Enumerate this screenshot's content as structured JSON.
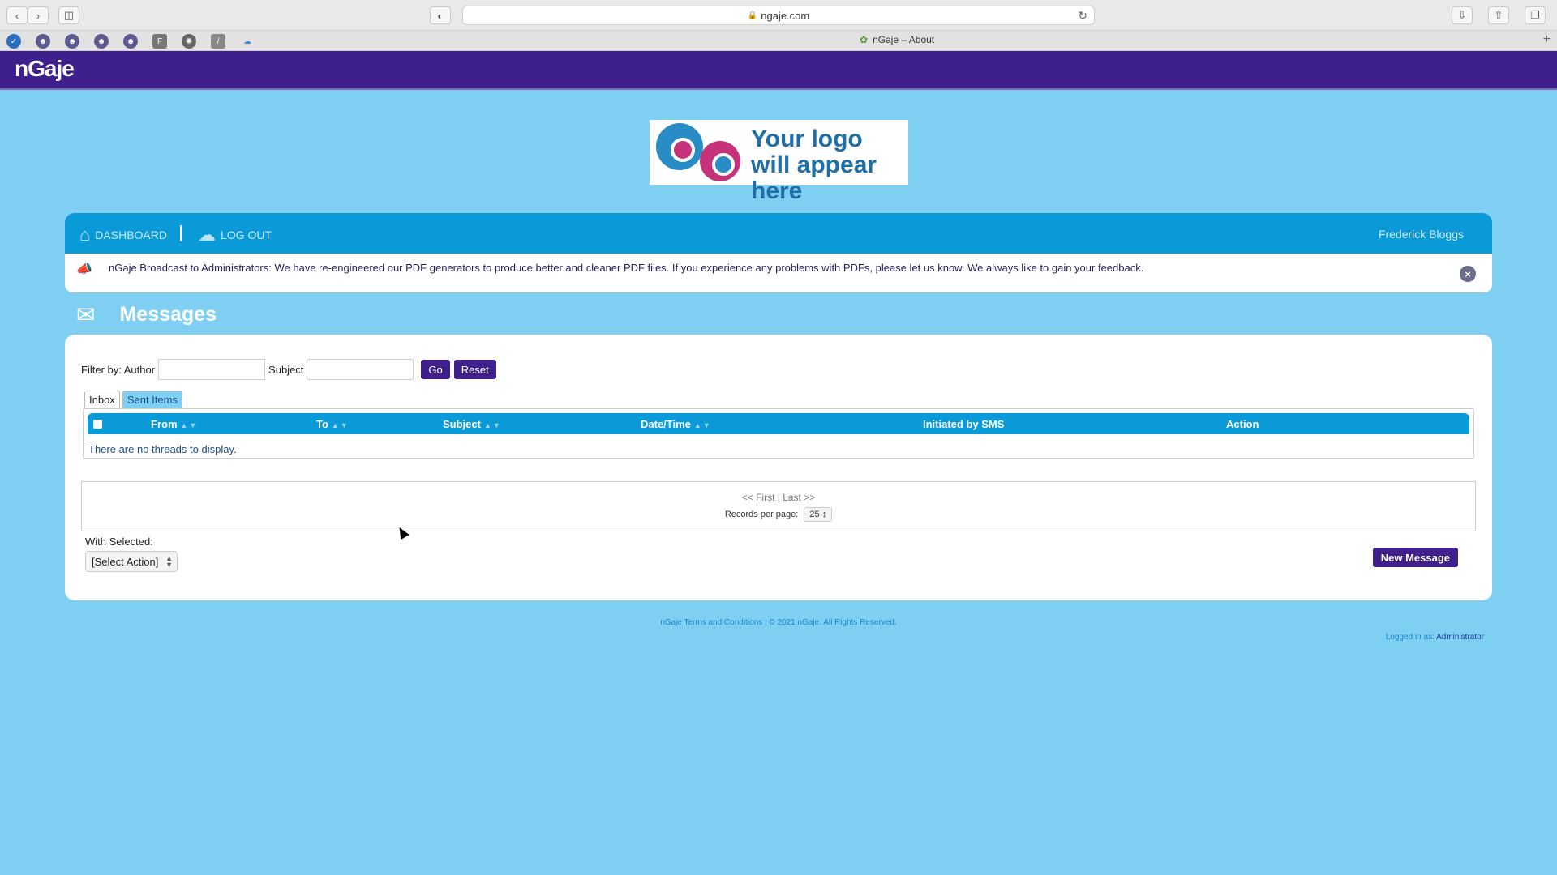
{
  "browser": {
    "url": "ngaje.com",
    "tab_title": "nGaje – About"
  },
  "app": {
    "brand": "nGaje"
  },
  "client_logo": {
    "text": "Your logo will appear here"
  },
  "nav": {
    "dashboard": "DASHBOARD",
    "logout": "LOG OUT",
    "user": "Frederick Bloggs"
  },
  "broadcast": {
    "message": "nGaje Broadcast to Administrators: We have re-engineered our PDF generators to produce better and cleaner PDF files. If you experience any problems with PDFs, please let us know. We always like to gain your feedback."
  },
  "page": {
    "title": "Messages"
  },
  "filter": {
    "label_author": "Filter by: Author",
    "label_subject": "Subject",
    "author_value": "",
    "subject_value": "",
    "go": "Go",
    "reset": "Reset"
  },
  "tabs": {
    "inbox": "Inbox",
    "sent": "Sent Items"
  },
  "table": {
    "columns": [
      "From",
      "To",
      "Subject",
      "Date/Time",
      "Initiated by SMS",
      "Action"
    ],
    "empty_message": "There are no threads to display."
  },
  "pager": {
    "links": "<< First | Last >>",
    "records_label": "Records per page:",
    "records_value": "25"
  },
  "bulk": {
    "label": "With Selected:",
    "select_value": "[Select Action]"
  },
  "actions": {
    "new_message": "New Message"
  },
  "footer": {
    "text": "nGaje Terms and Conditions  |  © 2021 nGaje. All Rights Reserved.",
    "logged_label": "Logged in as:",
    "logged_user": "Administrator"
  },
  "colors": {
    "page_bg": "#7fcff2",
    "header_purple": "#3e1f8c",
    "nav_blue": "#0a9ad8"
  }
}
